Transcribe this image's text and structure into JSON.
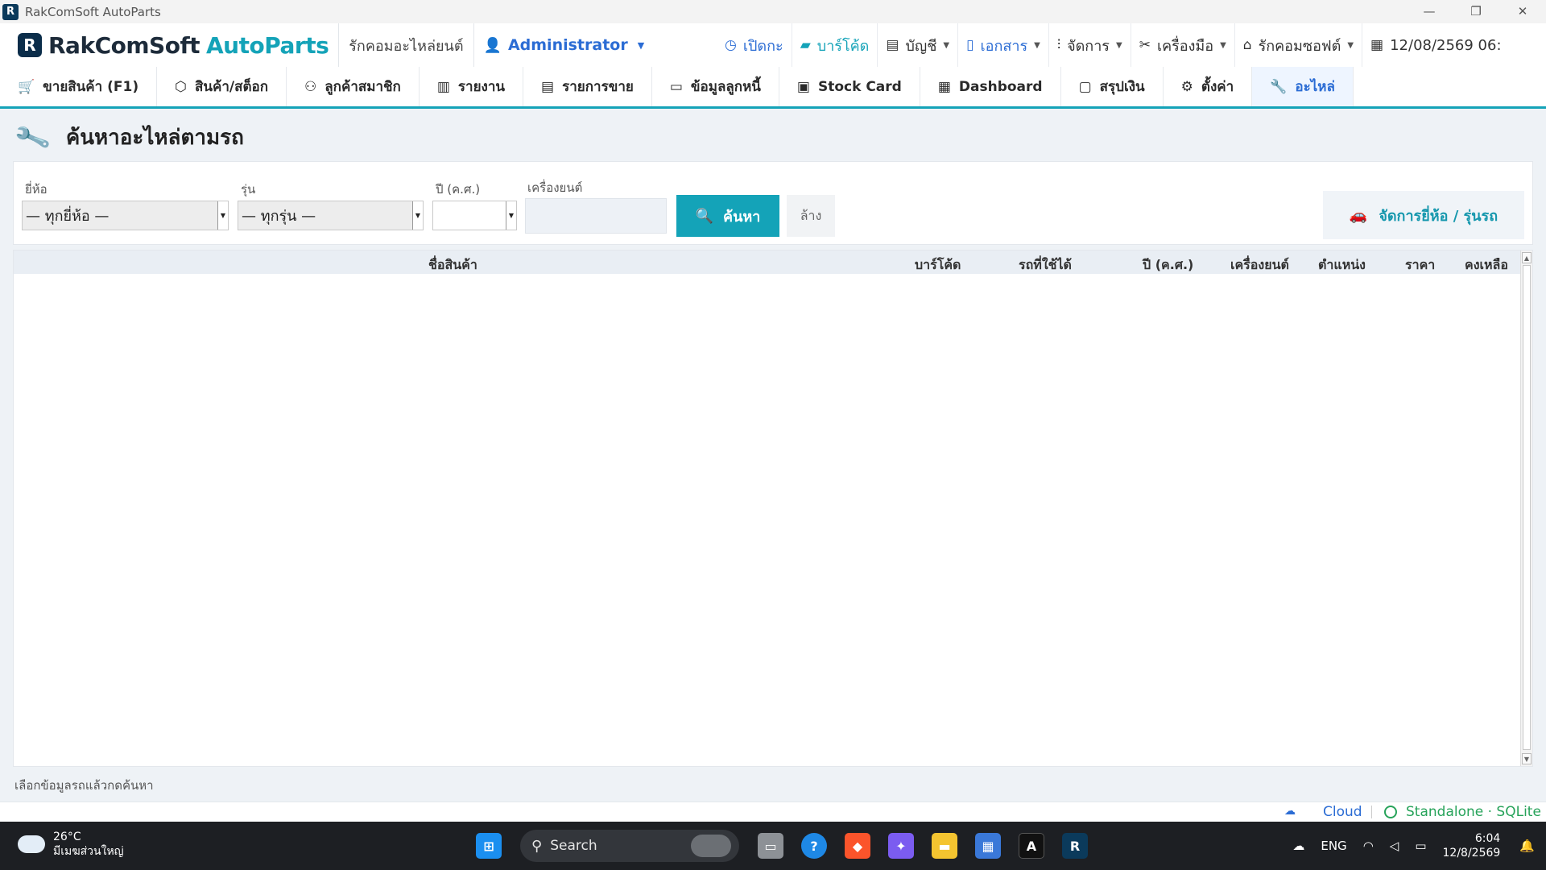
{
  "window": {
    "title": "RakComSoft AutoParts",
    "controls": [
      "—",
      "❐",
      "✕"
    ]
  },
  "header": {
    "brand_part1": "RakComSoft",
    "brand_part2": "AutoParts",
    "shop_name": "รักคอมอะไหล่ยนต์",
    "user": "Administrator",
    "items": [
      {
        "label": "เปิดกะ",
        "icon": "clock-icon"
      },
      {
        "label": "บาร์โค้ด",
        "icon": "barcode-tag-icon"
      },
      {
        "label": "บัญชี",
        "icon": "ledger-icon"
      },
      {
        "label": "เอกสาร",
        "icon": "document-icon"
      },
      {
        "label": "จัดการ",
        "icon": "sliders-icon"
      },
      {
        "label": "เครื่องมือ",
        "icon": "tools-icon"
      },
      {
        "label": "รักคอมซอฟต์",
        "icon": "home-icon"
      },
      {
        "label": "12/08/2569  06:",
        "icon": "calendar-icon"
      }
    ]
  },
  "nav": {
    "tabs": [
      {
        "label": "ขายสินค้า (F1)",
        "icon": "cart-icon"
      },
      {
        "label": "สินค้า/สต็อก",
        "icon": "box-icon"
      },
      {
        "label": "ลูกค้าสมาชิก",
        "icon": "users-icon"
      },
      {
        "label": "รายงาน",
        "icon": "bar-chart-icon"
      },
      {
        "label": "รายการขาย",
        "icon": "receipt-icon"
      },
      {
        "label": "ข้อมูลลูกหนี้",
        "icon": "credit-card-icon"
      },
      {
        "label": "Stock Card",
        "icon": "clipboard-icon"
      },
      {
        "label": "Dashboard",
        "icon": "grid-icon"
      },
      {
        "label": "สรุปเงิน",
        "icon": "wallet-icon"
      },
      {
        "label": "ตั้งค่า",
        "icon": "gear-icon"
      },
      {
        "label": "อะไหล่",
        "icon": "wrench-icon"
      }
    ],
    "active_index": 10
  },
  "page": {
    "title": "ค้นหาอะไหล่ตามรถ"
  },
  "filters": {
    "brand_label": "ยี่ห้อ",
    "brand_value": "— ทุกยี่ห้อ —",
    "model_label": "รุ่น",
    "model_value": "— ทุกรุ่น —",
    "year_label": "ปี (ค.ศ.)",
    "year_value": "",
    "engine_label": "เครื่องยนต์",
    "engine_value": "",
    "search_label": "ค้นหา",
    "clear_label": "ล้าง",
    "manage_label": "จัดการยี่ห้อ / รุ่นรถ"
  },
  "table": {
    "columns": [
      "ชื่อสินค้า",
      "บาร์โค้ด",
      "รถที่ใช้ได้",
      "ปี (ค.ศ.)",
      "เครื่องยนต์",
      "ตำแหน่ง",
      "ราคา",
      "คงเหลือ"
    ],
    "rows": []
  },
  "status": {
    "hint": "เลือกข้อมูลรถแล้วกดค้นหา",
    "cloud": "Cloud",
    "mode": "Standalone · SQLite"
  },
  "taskbar": {
    "temp": "26°C",
    "weather": "มีเมฆส่วนใหญ่",
    "search": "Search",
    "lang": "ENG",
    "time": "6:04",
    "date": "12/8/2569"
  },
  "colors": {
    "accent": "#14a3b8",
    "link_blue": "#2b6cd4",
    "brand_dark": "#1d2b3a",
    "standalone_green": "#27a35a"
  }
}
